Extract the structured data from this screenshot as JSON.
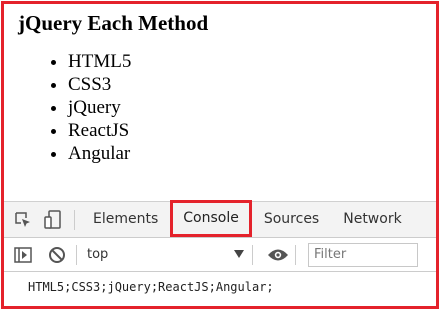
{
  "page": {
    "heading": "jQuery Each Method",
    "items": [
      "HTML5",
      "CSS3",
      "jQuery",
      "ReactJS",
      "Angular"
    ]
  },
  "devtools": {
    "tabs": [
      "Elements",
      "Console",
      "Sources",
      "Network"
    ],
    "active_tab": "Console",
    "context_value": "top",
    "filter_placeholder": "Filter",
    "console_output": "HTML5;CSS3;jQuery;ReactJS;Angular;"
  },
  "colors": {
    "highlight": "#e4222b"
  },
  "icons": [
    "inspect-element-icon",
    "device-toolbar-icon",
    "sidebar-toggle-icon",
    "clear-console-icon",
    "dropdown-arrow-icon",
    "eye-icon"
  ]
}
